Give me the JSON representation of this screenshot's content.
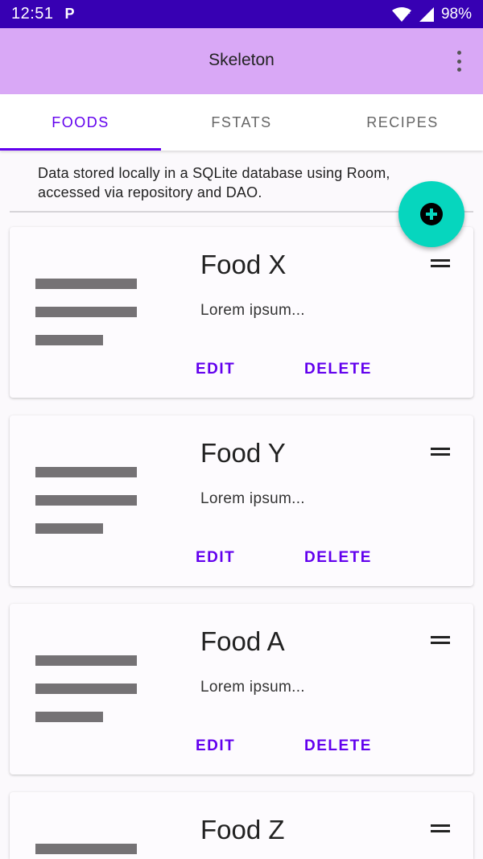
{
  "status_bar": {
    "time": "12:51",
    "notification": "P",
    "battery": "98%"
  },
  "app_bar": {
    "title": "Skeleton"
  },
  "tabs": [
    {
      "label": "FOODS",
      "active": true
    },
    {
      "label": "FSTATS",
      "active": false
    },
    {
      "label": "RECIPES",
      "active": false
    }
  ],
  "description": "Data stored locally in a SQLite database using Room, accessed via repository and DAO.",
  "fab": {
    "icon": "add-circle-icon",
    "color": "#06d6be"
  },
  "cards": [
    {
      "title": "Food X",
      "body": "Lorem ipsum...",
      "edit_label": "EDIT",
      "delete_label": "DELETE"
    },
    {
      "title": "Food Y",
      "body": "Lorem ipsum...",
      "edit_label": "EDIT",
      "delete_label": "DELETE"
    },
    {
      "title": "Food A",
      "body": "Lorem ipsum...",
      "edit_label": "EDIT",
      "delete_label": "DELETE"
    },
    {
      "title": "Food Z",
      "body": "",
      "edit_label": "",
      "delete_label": ""
    }
  ],
  "colors": {
    "primary": "#6200ee",
    "status_bar": "#3700b3",
    "app_bar": "#d9a8f6",
    "fab": "#06d6be"
  }
}
